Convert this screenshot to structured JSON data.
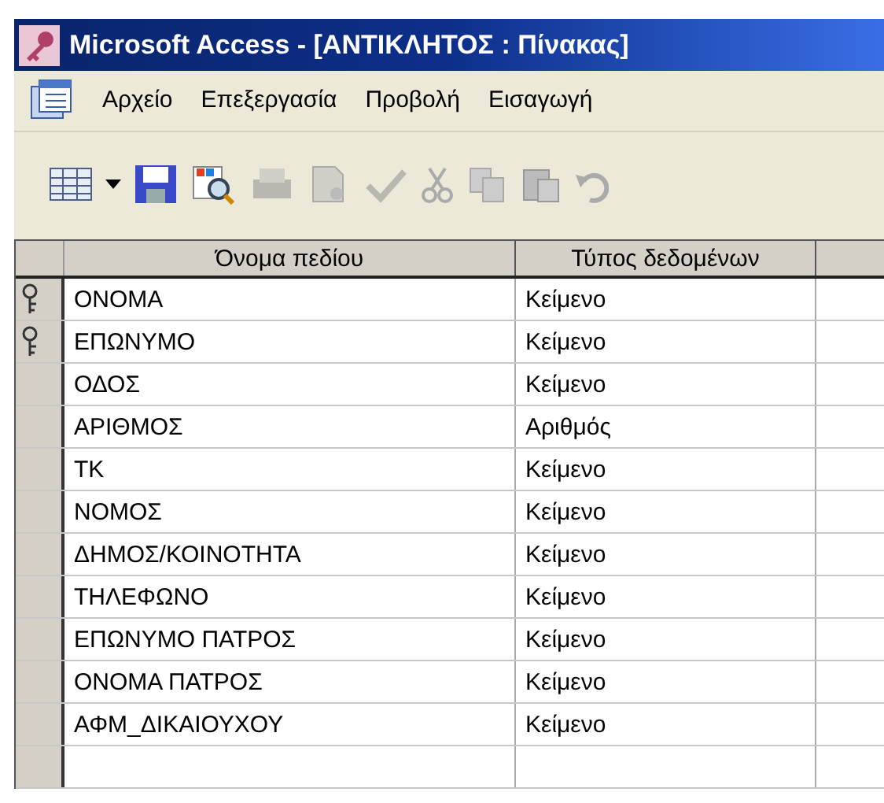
{
  "window": {
    "title": "Microsoft Access - [ΑΝΤΙΚΛΗΤΟΣ : Πίνακας]"
  },
  "menu": [
    "Αρχείο",
    "Επεξεργασία",
    "Προβολή",
    "Εισαγωγή"
  ],
  "table": {
    "columns": [
      "Όνομα πεδίου",
      "Τύπος δεδομένων"
    ],
    "rows": [
      {
        "field": "ΟΝΟΜΑ",
        "type": "Κείμενο",
        "primary_key": true
      },
      {
        "field": "ΕΠΩΝΥΜΟ",
        "type": "Κείμενο",
        "primary_key": true
      },
      {
        "field": "ΟΔΟΣ",
        "type": "Κείμενο",
        "primary_key": false
      },
      {
        "field": "ΑΡΙΘΜΟΣ",
        "type": "Αριθμός",
        "primary_key": false
      },
      {
        "field": "ΤΚ",
        "type": "Κείμενο",
        "primary_key": false
      },
      {
        "field": "ΝΟΜΟΣ",
        "type": "Κείμενο",
        "primary_key": false
      },
      {
        "field": "ΔΗΜΟΣ/ΚΟΙΝΟΤΗΤΑ",
        "type": "Κείμενο",
        "primary_key": false
      },
      {
        "field": "ΤΗΛΕΦΩΝΟ",
        "type": "Κείμενο",
        "primary_key": false
      },
      {
        "field": "ΕΠΩΝΥΜΟ ΠΑΤΡΟΣ",
        "type": "Κείμενο",
        "primary_key": false
      },
      {
        "field": "ΟΝΟΜΑ ΠΑΤΡΟΣ",
        "type": "Κείμενο",
        "primary_key": false
      },
      {
        "field": "ΑΦΜ_ΔΙΚΑΙΟΥΧΟΥ",
        "type": "Κείμενο",
        "primary_key": false
      }
    ]
  }
}
